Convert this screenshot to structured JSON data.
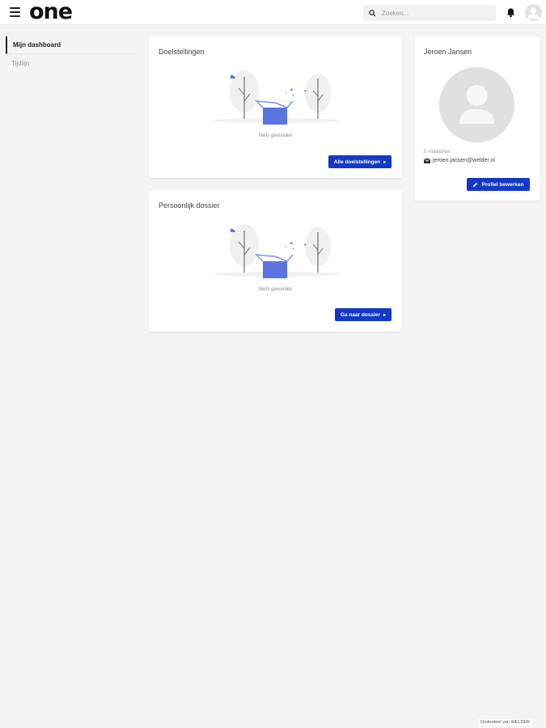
{
  "header": {
    "logo": "one",
    "search_placeholder": "Zoeken..."
  },
  "sidebar": {
    "items": [
      {
        "label": "Mijn dashboard"
      },
      {
        "label": "Tijdlijn"
      }
    ]
  },
  "cards": {
    "goals": {
      "title": "Doelstellingen",
      "empty_text": "Niets gevonden",
      "button_label": "Alle doelstellingen"
    },
    "dossier": {
      "title": "Persoonlijk dossier",
      "empty_text": "Niets gevonden",
      "button_label": "Ga naar dossier"
    },
    "profile": {
      "name": "Jeroen Jansen",
      "email_label": "E-mailadres",
      "email": "jeroen.jansen@welder.nl",
      "button_label": "Profiel bewerken"
    }
  },
  "footer": {
    "text": "Onderdeel van WELDER"
  },
  "colors": {
    "accent": "#1439c8",
    "illustration": "#5b74e0"
  },
  "icons": [
    "hamburger-icon",
    "search-icon",
    "bell-icon",
    "user-icon",
    "envelope-icon",
    "pencil-icon",
    "chevron-right-icon"
  ]
}
